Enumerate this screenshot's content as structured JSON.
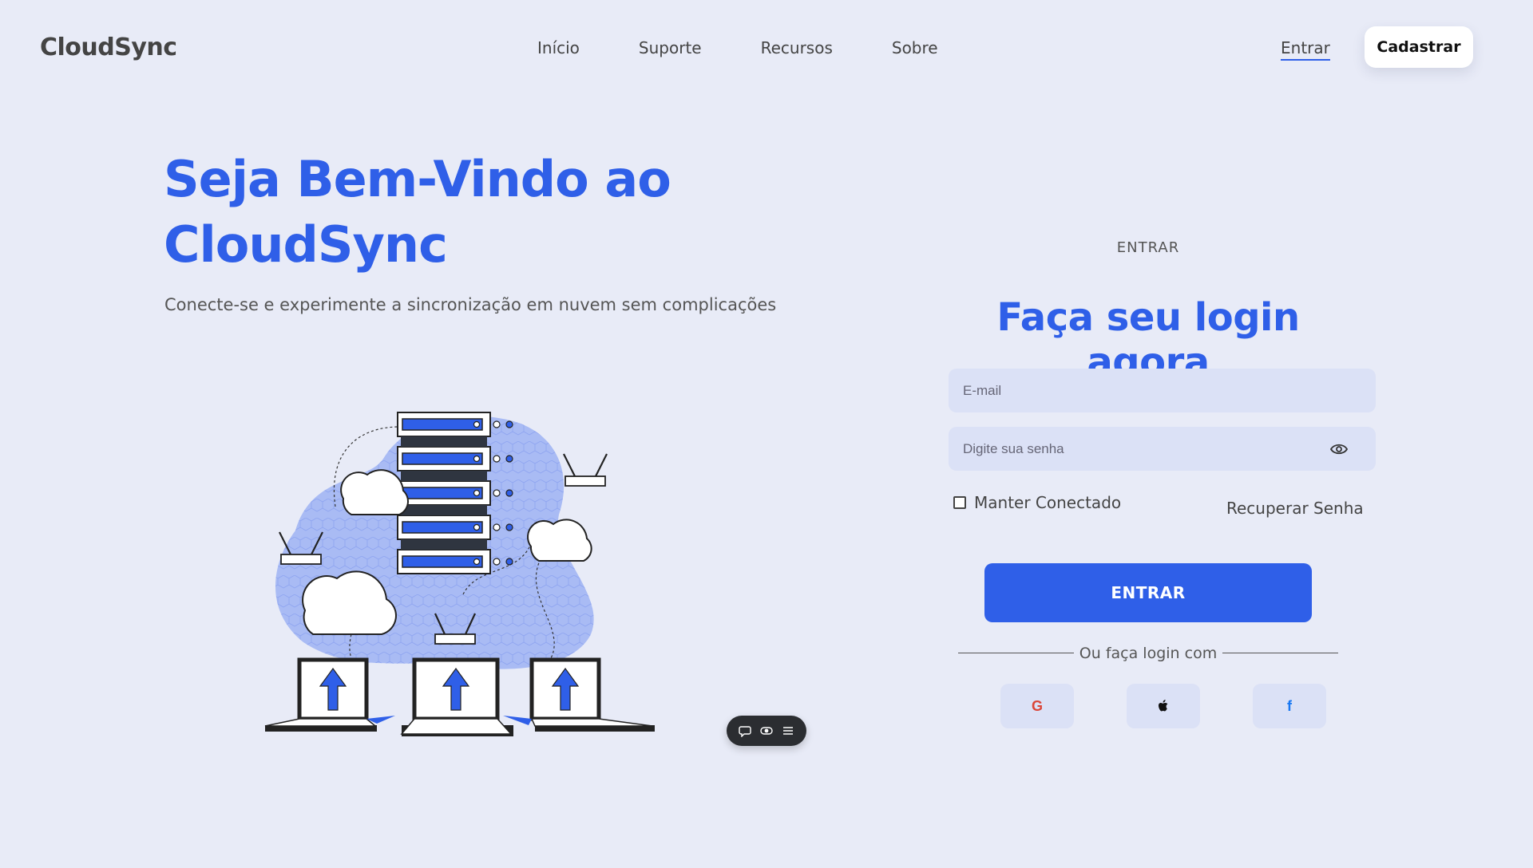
{
  "header": {
    "logo": "CloudSync",
    "nav": [
      "Início",
      "Suporte",
      "Recursos",
      "Sobre"
    ],
    "signin_label": "Entrar",
    "signup_label": "Cadastrar"
  },
  "hero": {
    "title": "Seja Bem-Vindo ao CloudSync",
    "subtitle": "Conecte-se e experimente a sincronização em nuvem sem complicações"
  },
  "login": {
    "overline": "ENTRAR",
    "title": "Faça seu login agora",
    "email_placeholder": "E-mail",
    "password_placeholder": "Digite sua senha",
    "remember_label": "Manter Conectado",
    "recover_label": "Recuperar Senha",
    "submit_label": "ENTRAR",
    "divider_text": "Ou faça login com",
    "social": [
      {
        "name": "google",
        "glyph": "G",
        "icon": "google-icon"
      },
      {
        "name": "apple",
        "glyph": "",
        "icon": "apple-icon"
      },
      {
        "name": "facebook",
        "glyph": "f",
        "icon": "facebook-icon"
      }
    ]
  },
  "colors": {
    "accent": "#2f5fe8",
    "background": "#e8ebf7",
    "input_bg": "#dbe1f6"
  }
}
